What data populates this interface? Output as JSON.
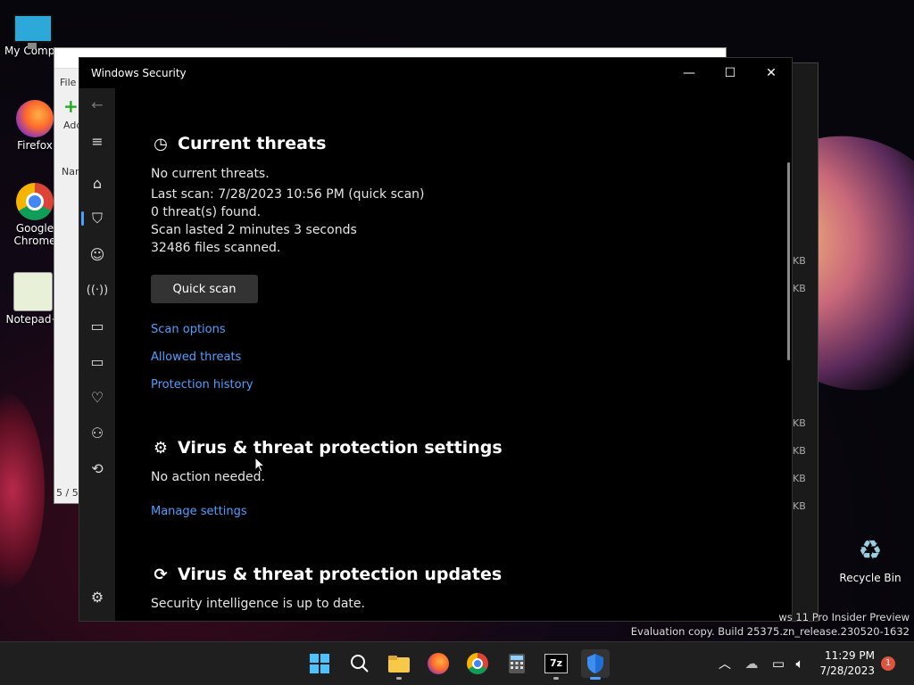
{
  "desktop": {
    "icons": [
      {
        "label": "My Compu",
        "icon": "computer-icon"
      },
      {
        "label": "Firefox",
        "icon": "firefox-icon"
      },
      {
        "label": "Google Chrome",
        "icon": "chrome-icon"
      },
      {
        "label": "Notepad+",
        "icon": "notepadpp-icon"
      },
      {
        "label": "Recycle Bin",
        "icon": "recycle-bin-icon"
      }
    ],
    "watermark": {
      "line1": "ws 11 Pro Insider Preview",
      "line2": "Evaluation copy. Build 25375.zn_release.230520-1632"
    }
  },
  "background_window": {
    "menu_first": "File",
    "add_label": "Add",
    "col_name": "Nan",
    "status": "5 / 5",
    "sizes": [
      "KB",
      "KB",
      "KB",
      "KB",
      "KB",
      "KB"
    ]
  },
  "window": {
    "title": "Windows Security",
    "controls": {
      "minimize": "—",
      "maximize": "☐",
      "close": "✕"
    }
  },
  "nav": {
    "items": [
      "back-arrow-icon",
      "menu-icon",
      "home-icon",
      "shield-icon",
      "person-icon",
      "wireless-icon",
      "app-browser-icon",
      "laptop-icon",
      "heart-pulse-icon",
      "family-icon",
      "history-icon",
      "settings-gear-icon"
    ],
    "active": "shield-icon"
  },
  "current_threats": {
    "heading": "Current threats",
    "no_threats": "No current threats.",
    "last_scan": "Last scan: 7/28/2023 10:56 PM (quick scan)",
    "threats_found": "0 threat(s) found.",
    "scan_duration": "Scan lasted 2 minutes 3 seconds",
    "files_scanned": "32486 files scanned.",
    "quick_scan_button": "Quick scan",
    "links": [
      "Scan options",
      "Allowed threats",
      "Protection history"
    ]
  },
  "settings_section": {
    "heading": "Virus & threat protection settings",
    "status": "No action needed.",
    "link": "Manage settings"
  },
  "updates_section": {
    "heading": "Virus & threat protection updates",
    "status": "Security intelligence is up to date."
  },
  "taskbar": {
    "apps": [
      "start-icon",
      "search-icon",
      "file-explorer-icon",
      "firefox-icon",
      "chrome-icon",
      "calculator-icon",
      "7zip-icon",
      "windows-security-icon"
    ],
    "time": "11:29 PM",
    "date": "7/28/2023",
    "notification_count": "1"
  },
  "colors": {
    "accent": "#4ea0ff",
    "window_bg": "#000000",
    "nav_bg": "#1c1c1c",
    "taskbar_bg": "#1f1f1f",
    "badge": "#e0533f"
  }
}
